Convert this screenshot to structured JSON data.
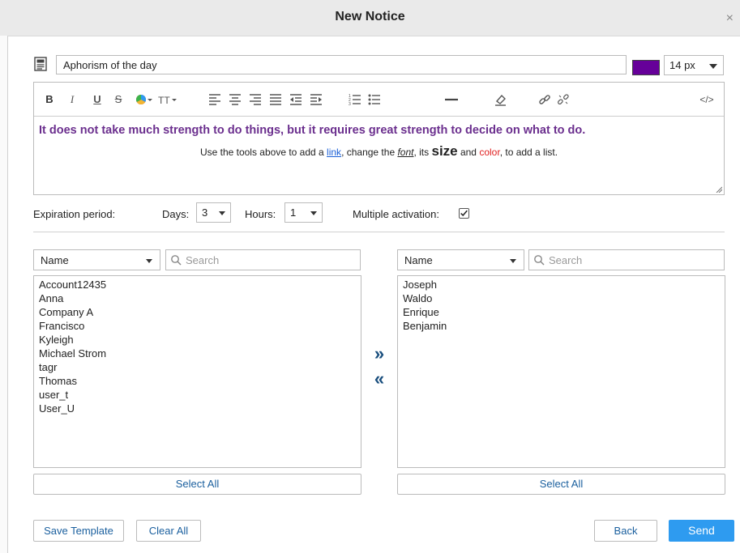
{
  "window": {
    "title": "New Notice",
    "close_glyph": "×"
  },
  "subject": {
    "value": "Aphorism of the day",
    "icon": "template-icon"
  },
  "font_color": "#660099",
  "font_size": {
    "selected": "14 px"
  },
  "toolbar": {
    "bold": "B",
    "italic": "I",
    "underline": "U",
    "strike": "S",
    "code": "</>"
  },
  "editor": {
    "headline": "It does not take much strength to do things, but it requires great strength to decide on what to do.",
    "hint_part1": "Use the tools above to add a ",
    "hint_link": "link",
    "hint_part2": ", change the ",
    "hint_font": "font",
    "hint_part3": ", its ",
    "hint_size": "size",
    "hint_part4": " and ",
    "hint_color": "color",
    "hint_part5": ", to add a list."
  },
  "expiration": {
    "label": "Expiration period:",
    "days_label": "Days:",
    "days_value": "3",
    "hours_label": "Hours:",
    "hours_value": "1",
    "multiple_label": "Multiple activation:",
    "multiple_checked": true
  },
  "left_panel": {
    "sort_by": "Name",
    "search_placeholder": "Search",
    "items": [
      "Account12435",
      "Anna",
      "Company A",
      "Francisco",
      "Kyleigh",
      "Michael Strom",
      "tagr",
      "Thomas",
      "user_t",
      "User_U"
    ],
    "select_all": "Select All"
  },
  "right_panel": {
    "sort_by": "Name",
    "search_placeholder": "Search",
    "items": [
      "Joseph",
      "Waldo",
      "Enrique",
      "Benjamin"
    ],
    "select_all": "Select All"
  },
  "move": {
    "add": "»",
    "remove": "«"
  },
  "footer": {
    "save_template": "Save Template",
    "clear_all": "Clear All",
    "back": "Back",
    "send": "Send"
  }
}
